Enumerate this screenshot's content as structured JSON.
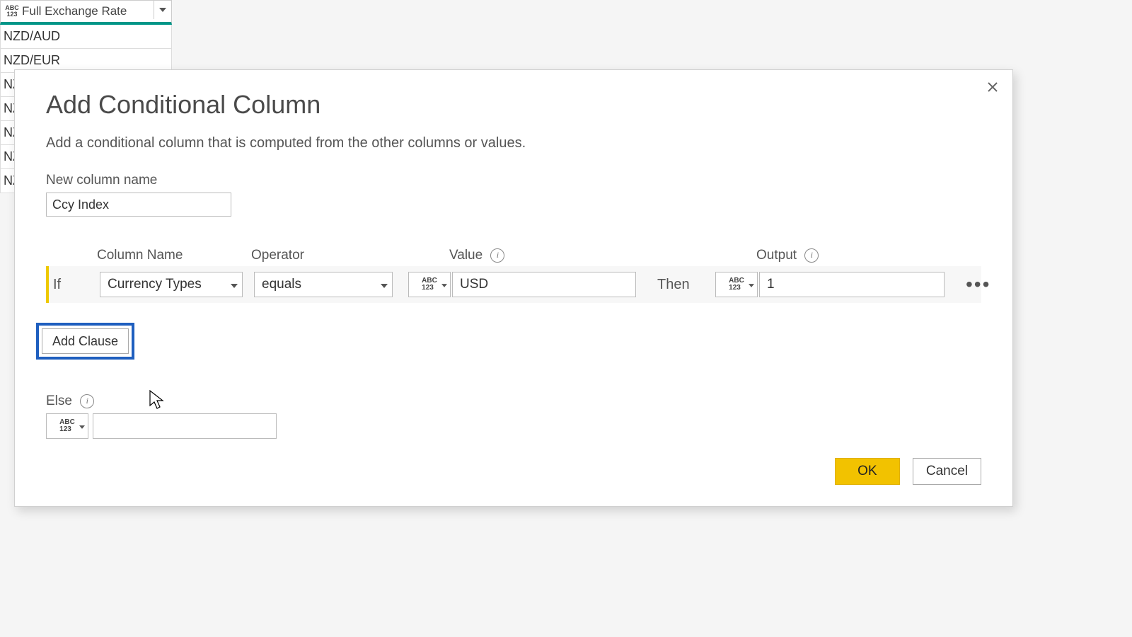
{
  "bg_table": {
    "column_header": "Full Exchange Rate",
    "type_glyph_top": "ABC",
    "type_glyph_bottom": "123",
    "rows": [
      "NZD/AUD",
      "NZD/EUR",
      "NZ",
      "NZ",
      "NZ",
      "NZ",
      "NZ"
    ]
  },
  "dialog": {
    "title": "Add Conditional Column",
    "description": "Add a conditional column that is computed from the other columns or values.",
    "new_column_label": "New column name",
    "new_column_value": "Ccy Index",
    "headers": {
      "column_name": "Column Name",
      "operator": "Operator",
      "value": "Value",
      "output": "Output"
    },
    "clause": {
      "if_label": "If",
      "column_name": "Currency Types",
      "operator": "equals",
      "value_type_top": "ABC",
      "value_type_bottom": "123",
      "value": "USD",
      "then_label": "Then",
      "output_type_top": "ABC",
      "output_type_bottom": "123",
      "output": "1",
      "more": "•••"
    },
    "add_clause_label": "Add Clause",
    "else_label": "Else",
    "else_type_top": "ABC",
    "else_type_bottom": "123",
    "else_value": "",
    "ok_label": "OK",
    "cancel_label": "Cancel"
  }
}
